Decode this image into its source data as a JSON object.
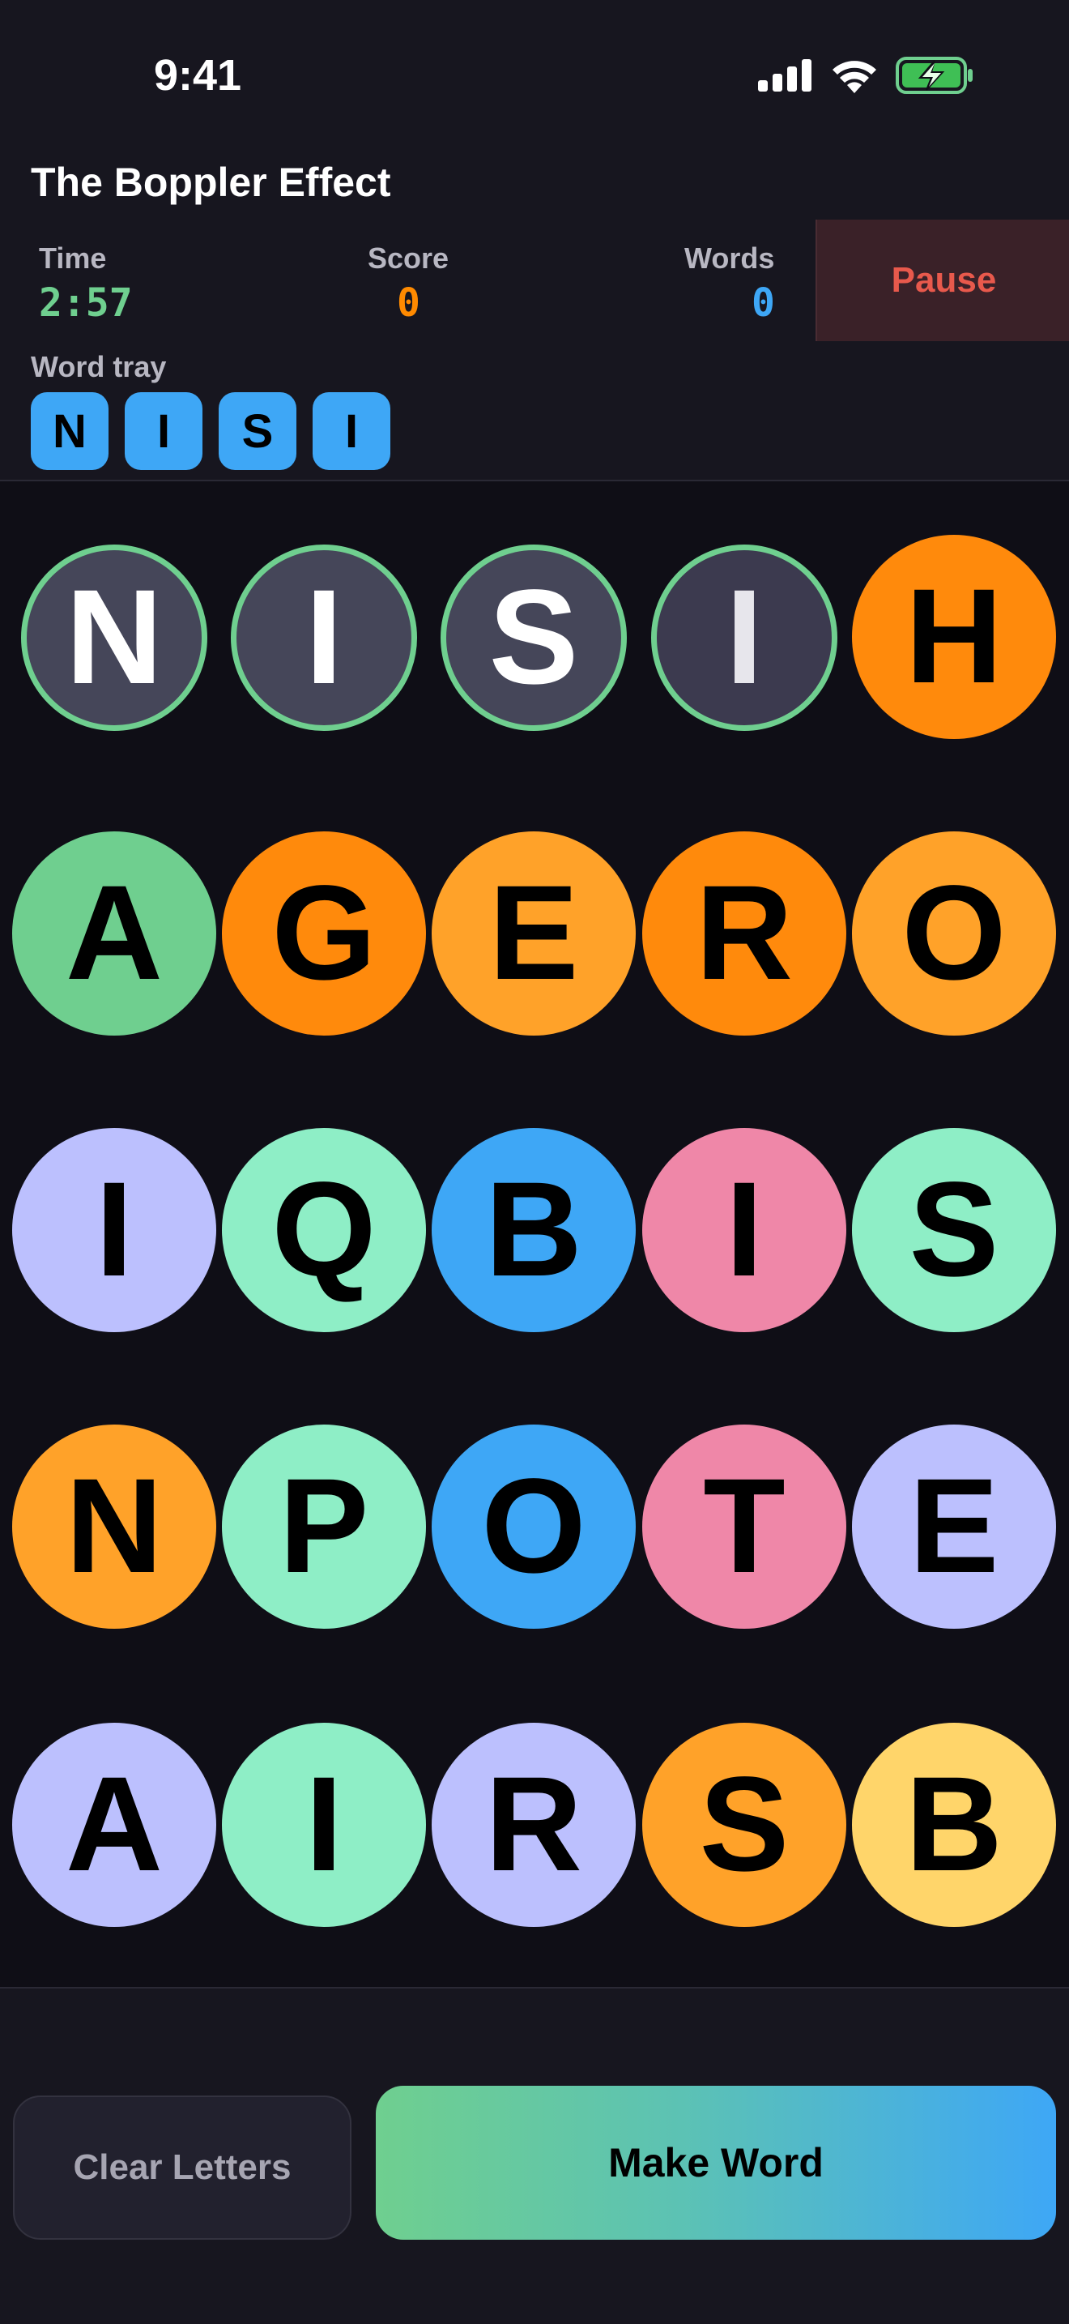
{
  "status_bar": {
    "time": "9:41",
    "icons": [
      "signal-icon",
      "wifi-icon",
      "battery-charging-icon"
    ]
  },
  "header": {
    "title": "The Boppler Effect",
    "pause_label": "Pause"
  },
  "stats": {
    "time": {
      "label": "Time",
      "value": "2:57",
      "color": "#6fcf8f"
    },
    "score": {
      "label": "Score",
      "value": "0",
      "color": "#ff8a00"
    },
    "words": {
      "label": "Words",
      "value": "0",
      "color": "#3ea7f6"
    }
  },
  "tray": {
    "label": "Word tray",
    "letters": [
      "N",
      "I",
      "S",
      "I"
    ]
  },
  "board": {
    "rows": [
      [
        {
          "letter": "N",
          "color": "#454659",
          "selected": true
        },
        {
          "letter": "I",
          "color": "#454659",
          "selected": true
        },
        {
          "letter": "S",
          "color": "#454659",
          "selected": true
        },
        {
          "letter": "I",
          "color": "#3c3a4f",
          "selected": true
        },
        {
          "letter": "H",
          "color": "#ff8a0c",
          "selected": false
        }
      ],
      [
        {
          "letter": "A",
          "color": "#6fcf8f",
          "selected": false
        },
        {
          "letter": "G",
          "color": "#ff8a0c",
          "selected": false
        },
        {
          "letter": "E",
          "color": "#ffa229",
          "selected": false
        },
        {
          "letter": "R",
          "color": "#ff8a0c",
          "selected": false
        },
        {
          "letter": "O",
          "color": "#ffa229",
          "selected": false
        }
      ],
      [
        {
          "letter": "I",
          "color": "#bcc0fe",
          "selected": false
        },
        {
          "letter": "Q",
          "color": "#8eeec6",
          "selected": false
        },
        {
          "letter": "B",
          "color": "#3ea7f6",
          "selected": false
        },
        {
          "letter": "I",
          "color": "#ef87a8",
          "selected": false
        },
        {
          "letter": "S",
          "color": "#8eeec6",
          "selected": false
        }
      ],
      [
        {
          "letter": "N",
          "color": "#ffa229",
          "selected": false
        },
        {
          "letter": "P",
          "color": "#8eeec6",
          "selected": false
        },
        {
          "letter": "O",
          "color": "#3ea7f6",
          "selected": false
        },
        {
          "letter": "T",
          "color": "#ef87a8",
          "selected": false
        },
        {
          "letter": "E",
          "color": "#bcc0fe",
          "selected": false
        }
      ],
      [
        {
          "letter": "A",
          "color": "#bcc0fe",
          "selected": false
        },
        {
          "letter": "I",
          "color": "#8eeec6",
          "selected": false
        },
        {
          "letter": "R",
          "color": "#bcc0fe",
          "selected": false
        },
        {
          "letter": "S",
          "color": "#ffa229",
          "selected": false
        },
        {
          "letter": "B",
          "color": "#ffd56a",
          "selected": false
        }
      ]
    ]
  },
  "actions": {
    "clear_label": "Clear Letters",
    "make_label": "Make Word"
  }
}
